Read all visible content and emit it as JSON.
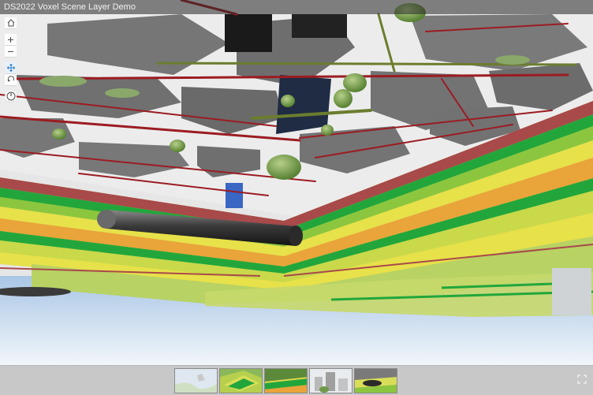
{
  "app": {
    "title": "DS2022 Voxel Scene Layer Demo"
  },
  "navigation": [
    {
      "name": "home-button",
      "icon": "home-icon"
    },
    {
      "name": "zoom-in-button",
      "icon": "plus-icon"
    },
    {
      "name": "zoom-out-button",
      "icon": "minus-icon"
    },
    {
      "name": "pan-button",
      "icon": "pan-icon",
      "active": true
    },
    {
      "name": "rotate-button",
      "icon": "rotate-icon"
    },
    {
      "name": "compass-button",
      "icon": "compass-icon"
    }
  ],
  "bookmarks": [
    {
      "name": "bookmark-overview",
      "icon": "map-thumbnail"
    },
    {
      "name": "bookmark-voxel-aerial",
      "icon": "voxel-thumbnail"
    },
    {
      "name": "bookmark-voxel-closeup",
      "icon": "voxel-thumbnail"
    },
    {
      "name": "bookmark-buildings",
      "icon": "buildings-thumbnail"
    },
    {
      "name": "bookmark-underground",
      "icon": "underground-thumbnail"
    }
  ],
  "colors": {
    "sky": "#c9ddf0",
    "voxel_green": "#22a63c",
    "voxel_yellow": "#e7e14a",
    "voxel_orange": "#e9a43a",
    "voxel_red": "#a8494a",
    "pipe_red": "#9b1c22",
    "pipe_green": "#6b7d2e"
  }
}
